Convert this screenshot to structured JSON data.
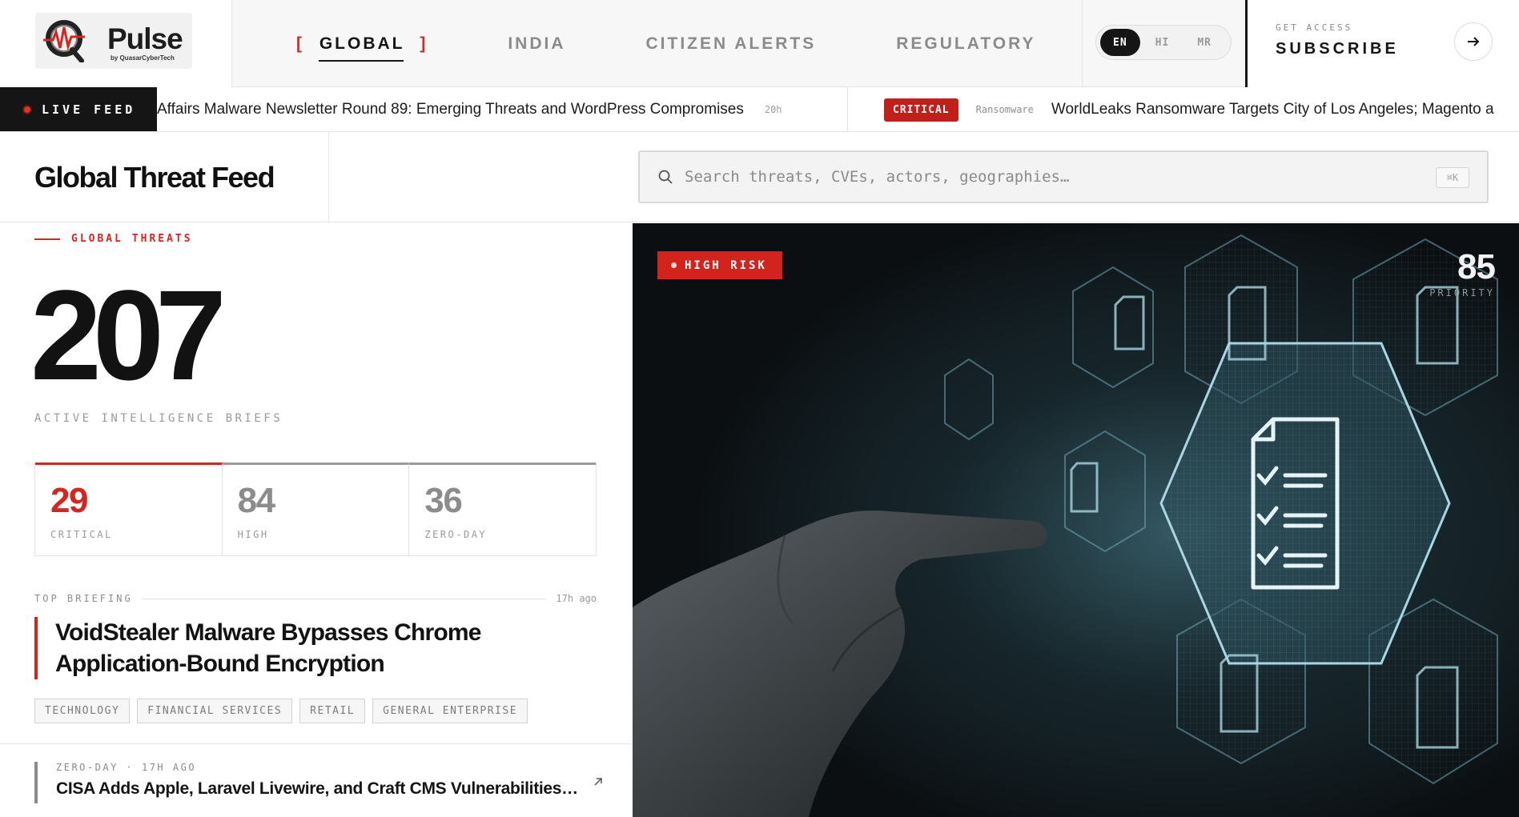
{
  "brand": {
    "name": "Pulse",
    "byline": "by QuasarCyberTech"
  },
  "nav": {
    "items": [
      {
        "label": "GLOBAL",
        "active": true
      },
      {
        "label": "INDIA",
        "active": false
      },
      {
        "label": "CITIZEN ALERTS",
        "active": false
      },
      {
        "label": "REGULATORY",
        "active": false
      }
    ],
    "active_bracket_open": "[",
    "active_bracket_close": "]"
  },
  "languages": [
    {
      "code": "EN",
      "active": true
    },
    {
      "code": "HI",
      "active": false
    },
    {
      "code": "MR",
      "active": false
    }
  ],
  "subscribe": {
    "kicker": "GET ACCESS",
    "label": "SUBSCRIBE",
    "icon": "arrow-right-icon"
  },
  "ticker": {
    "live_label": "LIVE FEED",
    "items": [
      {
        "title": "Affairs Malware Newsletter Round 89: Emerging Threats and WordPress Compromises",
        "time": "20h"
      },
      {
        "badge": "CRITICAL",
        "category": "Ransomware",
        "title": "WorldLeaks Ransomware Targets City of Los Angeles; Magento a"
      }
    ]
  },
  "page": {
    "title": "Global Threat Feed"
  },
  "search": {
    "placeholder": "Search threats, CVEs, actors, geographies…",
    "shortcut": "⌘K",
    "icon": "search-icon"
  },
  "summary": {
    "kicker": "GLOBAL THREATS",
    "total": "207",
    "total_label": "ACTIVE INTELLIGENCE BRIEFS",
    "stats": [
      {
        "value": "29",
        "label": "CRITICAL"
      },
      {
        "value": "84",
        "label": "HIGH"
      },
      {
        "value": "36",
        "label": "ZERO-DAY"
      }
    ]
  },
  "top_briefing": {
    "kicker": "TOP BRIEFING",
    "time": "17h ago",
    "title": "VoidStealer Malware Bypasses Chrome Application-Bound Encryption",
    "tags": [
      "TECHNOLOGY",
      "FINANCIAL SERVICES",
      "RETAIL",
      "GENERAL ENTERPRISE"
    ]
  },
  "secondary_briefing": {
    "meta": "ZERO-DAY · 17H AGO",
    "title": "CISA Adds Apple, Laravel Livewire, and Craft CMS Vulnerabilities…",
    "icon": "external-arrow-icon"
  },
  "hero": {
    "risk_label": "HIGH RISK",
    "priority_value": "85",
    "priority_label": "PRIORITY"
  },
  "colors": {
    "accent_red": "#d3261f",
    "ink": "#141414",
    "muted": "#8c8c8c",
    "hero_bg": "#0b0f11",
    "hero_glow": "#6fa7b8"
  }
}
